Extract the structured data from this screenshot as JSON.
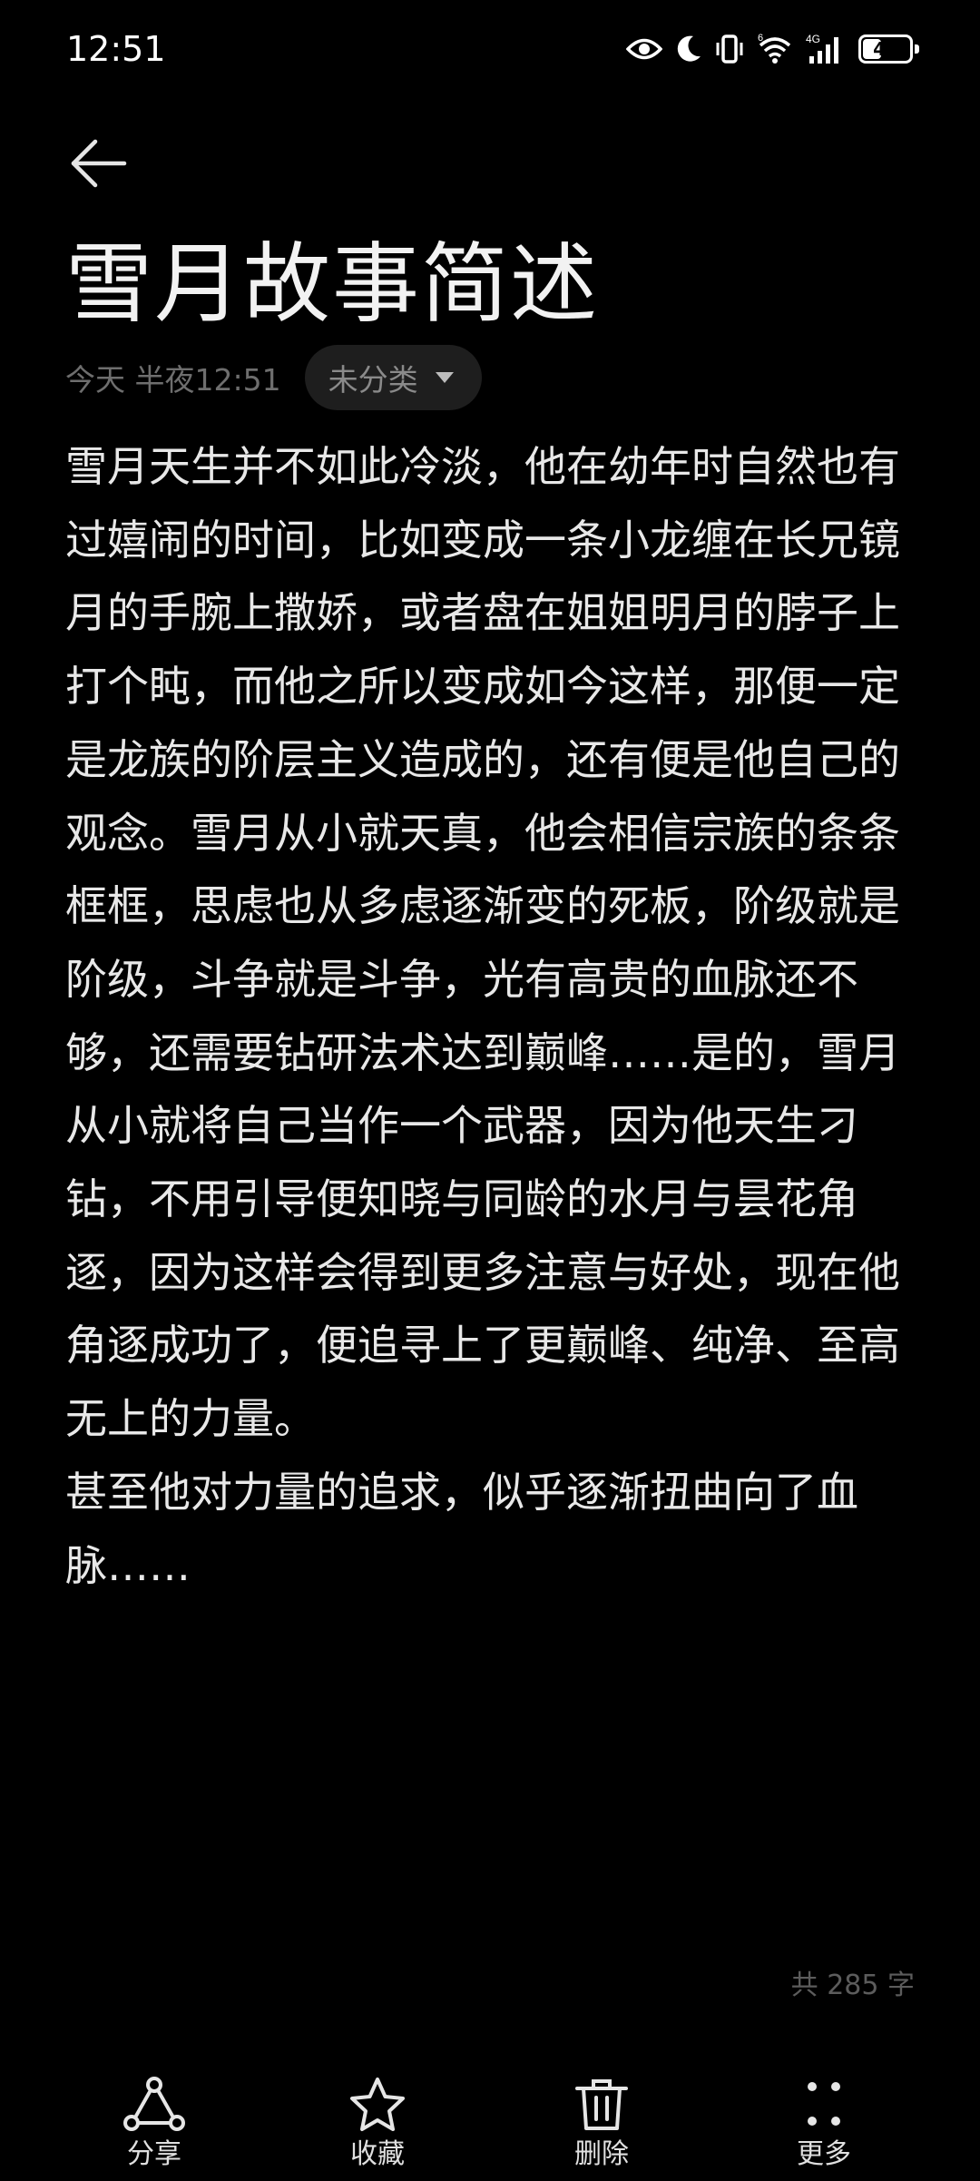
{
  "status_bar": {
    "time": "12:51",
    "battery_level": "44",
    "network_label": "4G",
    "wifi_label": "6",
    "icons": [
      "eye-icon",
      "moon-icon",
      "vibrate-icon",
      "wifi-icon",
      "signal-icon",
      "battery-icon"
    ]
  },
  "header": {
    "title": "雪月故事简述",
    "date": "今天 半夜12:51",
    "category": "未分类"
  },
  "note": {
    "paragraphs": [
      "雪月天生并不如此冷淡，他在幼年时自然也有过嬉闹的时间，比如变成一条小龙缠在长兄镜月的手腕上撒娇，或者盘在姐姐明月的脖子上打个盹，而他之所以变成如今这样，那便一定是龙族的阶层主义造成的，还有便是他自己的观念。雪月从小就天真，他会相信宗族的条条框框，思虑也从多虑逐渐变的死板，阶级就是阶级，斗争就是斗争，光有高贵的血脉还不够，还需要钻研法术达到巅峰……是的，雪月从小就将自己当作一个武器，因为他天生刁钻，不用引导便知晓与同龄的水月与昙花角逐，因为这样会得到更多注意与好处，现在他角逐成功了，便追寻上了更巅峰、纯净、至高无上的力量。",
      "甚至他对力量的追求，似乎逐渐扭曲向了血脉……"
    ]
  },
  "footer": {
    "word_count": "共 285 字"
  },
  "toolbar": {
    "share": "分享",
    "favorite": "收藏",
    "delete": "删除",
    "more": "更多"
  },
  "colors": {
    "background": "#000000",
    "text": "#e8e8e8",
    "muted": "#6e6e6e",
    "chip": "#1e1e1e"
  }
}
